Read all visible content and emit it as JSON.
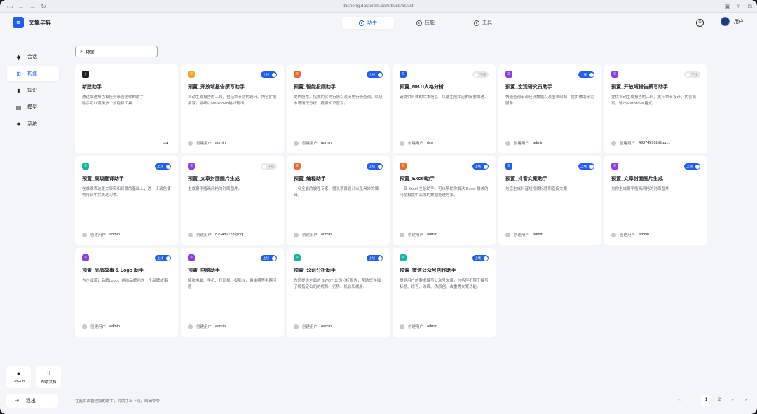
{
  "browser": {
    "url": "bisheng.dataelem.com/build/assist"
  },
  "brand": {
    "logo_glyph": "≡",
    "name": "文擎毕昇"
  },
  "topnav": {
    "tabs": [
      {
        "label": "助手",
        "icon": "assistant-icon",
        "active": true
      },
      {
        "label": "技能",
        "icon": "skill-icon",
        "active": false
      },
      {
        "label": "工具",
        "icon": "tool-icon",
        "active": false
      }
    ],
    "user_label": "用户"
  },
  "sidebar": {
    "items": [
      {
        "label": "会话",
        "icon": "chat-icon"
      },
      {
        "label": "构建",
        "icon": "build-icon",
        "active": true
      },
      {
        "label": "知识",
        "icon": "knowledge-icon"
      },
      {
        "label": "模型",
        "icon": "model-icon"
      },
      {
        "label": "系统",
        "icon": "settings-icon"
      }
    ],
    "github_label": "GitHub",
    "docs_label": "帮助文档",
    "logout_label": "退出"
  },
  "search": {
    "value": "预置"
  },
  "new_card": {
    "title": "新建助手",
    "desc": "通过描述角色和任务来创建你的助手\n助手可以调用多个技能和工具"
  },
  "creator_prefix": "创建用户",
  "toggle_on_label": "上线",
  "toggle_off_label": "下线",
  "colors": {
    "accent": "#1f5df6",
    "yellow": "#f5a623",
    "orange": "#f06a28",
    "blue": "#1f5df6",
    "purple": "#8b3fe6",
    "teal": "#14b5a2"
  },
  "cards": [
    {
      "title": "预置_开放域报告撰写助手",
      "desc": "自动生成报告的工具，包括章节结构设计、内容扩展撰写，最终以Markdown格式输出。",
      "user": "admin",
      "online": true,
      "color": "#f5a623"
    },
    {
      "title": "预置_智能投顾助手",
      "desc": "提供股票、指数的实时行情以及历史行情查询，以及市场情况分析，投资知识普及。",
      "user": "admin",
      "online": true,
      "color": "#f06a28"
    },
    {
      "title": "预置_MBTI人格分析",
      "desc": "请提供具体的文本信息，以便生成相应的简要描述。",
      "user": "rico",
      "online": false,
      "color": "#1f5df6"
    },
    {
      "title": "预置_宏观研究员助手",
      "desc": "快速查询宏观经济数据以及图表绘制，提供辅助研究服务。",
      "user": "admin",
      "online": true,
      "color": "#8b3fe6"
    },
    {
      "title": "预置_开放域报告撰写助手",
      "desc": "提供自动生成报告的工具，支持章节设计、内容撰写，输出Markdown格式。",
      "user": "498745918@qq....",
      "online": false,
      "color": "#8b3fe6"
    },
    {
      "title": "预置_高级翻译助手",
      "desc": "在准确表达原文事实和背景的基础上，进一步润色使得符合中文表达习惯。",
      "user": "admin",
      "online": true,
      "color": "#14b5a2"
    },
    {
      "title": "预置_文章封面图片生成",
      "desc": "生成扁平插画风格的封面图片。",
      "user": "879486228@qq....",
      "online": false,
      "color": "#8b3fe6"
    },
    {
      "title": "预置_编程助手",
      "desc": "一名全能的编程专家，擅长项目设计以及具体的编码。",
      "user": "admin",
      "online": true,
      "color": "#f06a28"
    },
    {
      "title": "预置_Excel助手",
      "desc": "一名 Excel 全能助手，可以帮助你解决 Excel 相关的问题和提供高效的数据处理方案。",
      "user": "admin",
      "online": true,
      "color": "#f06a28"
    },
    {
      "title": "预置_抖音文案助手",
      "desc": "为您生成抖音短视频标题和宣传文案",
      "user": "admin",
      "online": true,
      "color": "#1f5df6"
    },
    {
      "title": "预置_文章封面图片生成",
      "desc": "为你生成扁平插画风格的封面图片",
      "user": "admin",
      "online": true,
      "color": "#8b3fe6"
    },
    {
      "title": "预置_品牌故事 & Logo 助手",
      "desc": "为企业设计品牌Logo，并给品牌创作一个品牌故事",
      "user": "admin",
      "online": true,
      "color": "#8b3fe6"
    },
    {
      "title": "预置_电脑助手",
      "desc": "解决电脑、手机、打印机、投影仪、路由器等电器问题",
      "user": "admin",
      "online": true,
      "color": "#8b3fe6"
    },
    {
      "title": "预置_公司分析助手",
      "desc": "为您提供全面的 SWOT 公司分析报告，帮助您详细了解指定公司的优势、劣势、机会和威胁。",
      "user": "admin",
      "online": true,
      "color": "#14b5a2"
    },
    {
      "title": "预置_微信公众号创作助手",
      "desc": "根据用户的要求编写公众号文章，包括但不限于撰写标题、续写、改编、伪原创、去重等文案功能。",
      "user": "admin",
      "online": true,
      "color": "#14b5a2"
    }
  ],
  "footer": {
    "text": "在此页面管理您的助手，对助手上下线、编辑等等"
  },
  "pagination": {
    "pages": [
      "1",
      "2"
    ],
    "current": "1",
    "first": "«",
    "prev": "‹",
    "next": "›",
    "last": "»"
  }
}
